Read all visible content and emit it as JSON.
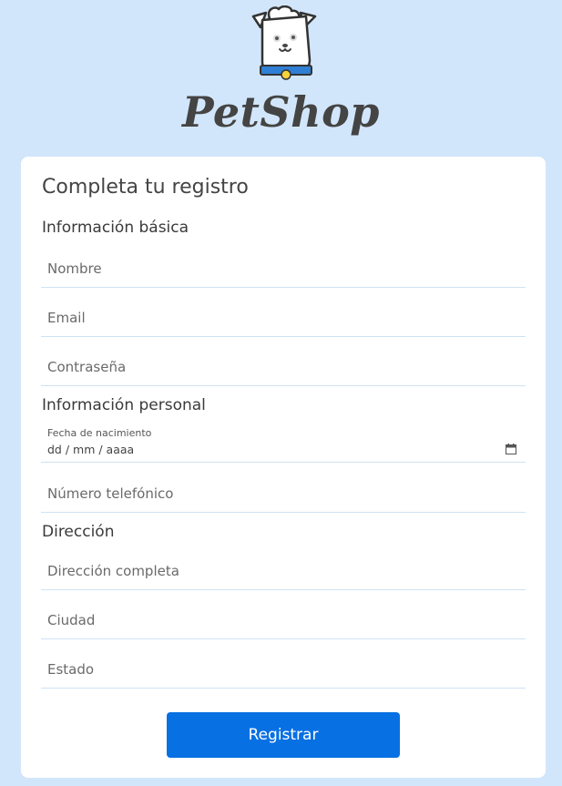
{
  "brand": {
    "name": "PetShop"
  },
  "form": {
    "title": "Completa tu registro",
    "sections": {
      "basic": "Información básica",
      "personal": "Información personal",
      "address": "Dirección"
    },
    "fields": {
      "nombre": {
        "placeholder": "Nombre",
        "value": ""
      },
      "email": {
        "placeholder": "Email",
        "value": ""
      },
      "contrasena": {
        "placeholder": "Contraseña",
        "value": ""
      },
      "fecha_nacimiento": {
        "label": "Fecha de nacimiento",
        "value": "dd / mm / aaaa"
      },
      "telefono": {
        "placeholder": "Número telefónico",
        "value": ""
      },
      "direccion": {
        "placeholder": "Dirección completa",
        "value": ""
      },
      "ciudad": {
        "placeholder": "Ciudad",
        "value": ""
      },
      "estado": {
        "placeholder": "Estado",
        "value": ""
      }
    },
    "submit_label": "Registrar"
  },
  "icons": {
    "logo": "dog-chef-icon",
    "date": "calendar-icon"
  },
  "colors": {
    "background": "#d2e6fb",
    "button": "#0770e3",
    "card": "#ffffff",
    "field_border": "#cfe2f3"
  }
}
